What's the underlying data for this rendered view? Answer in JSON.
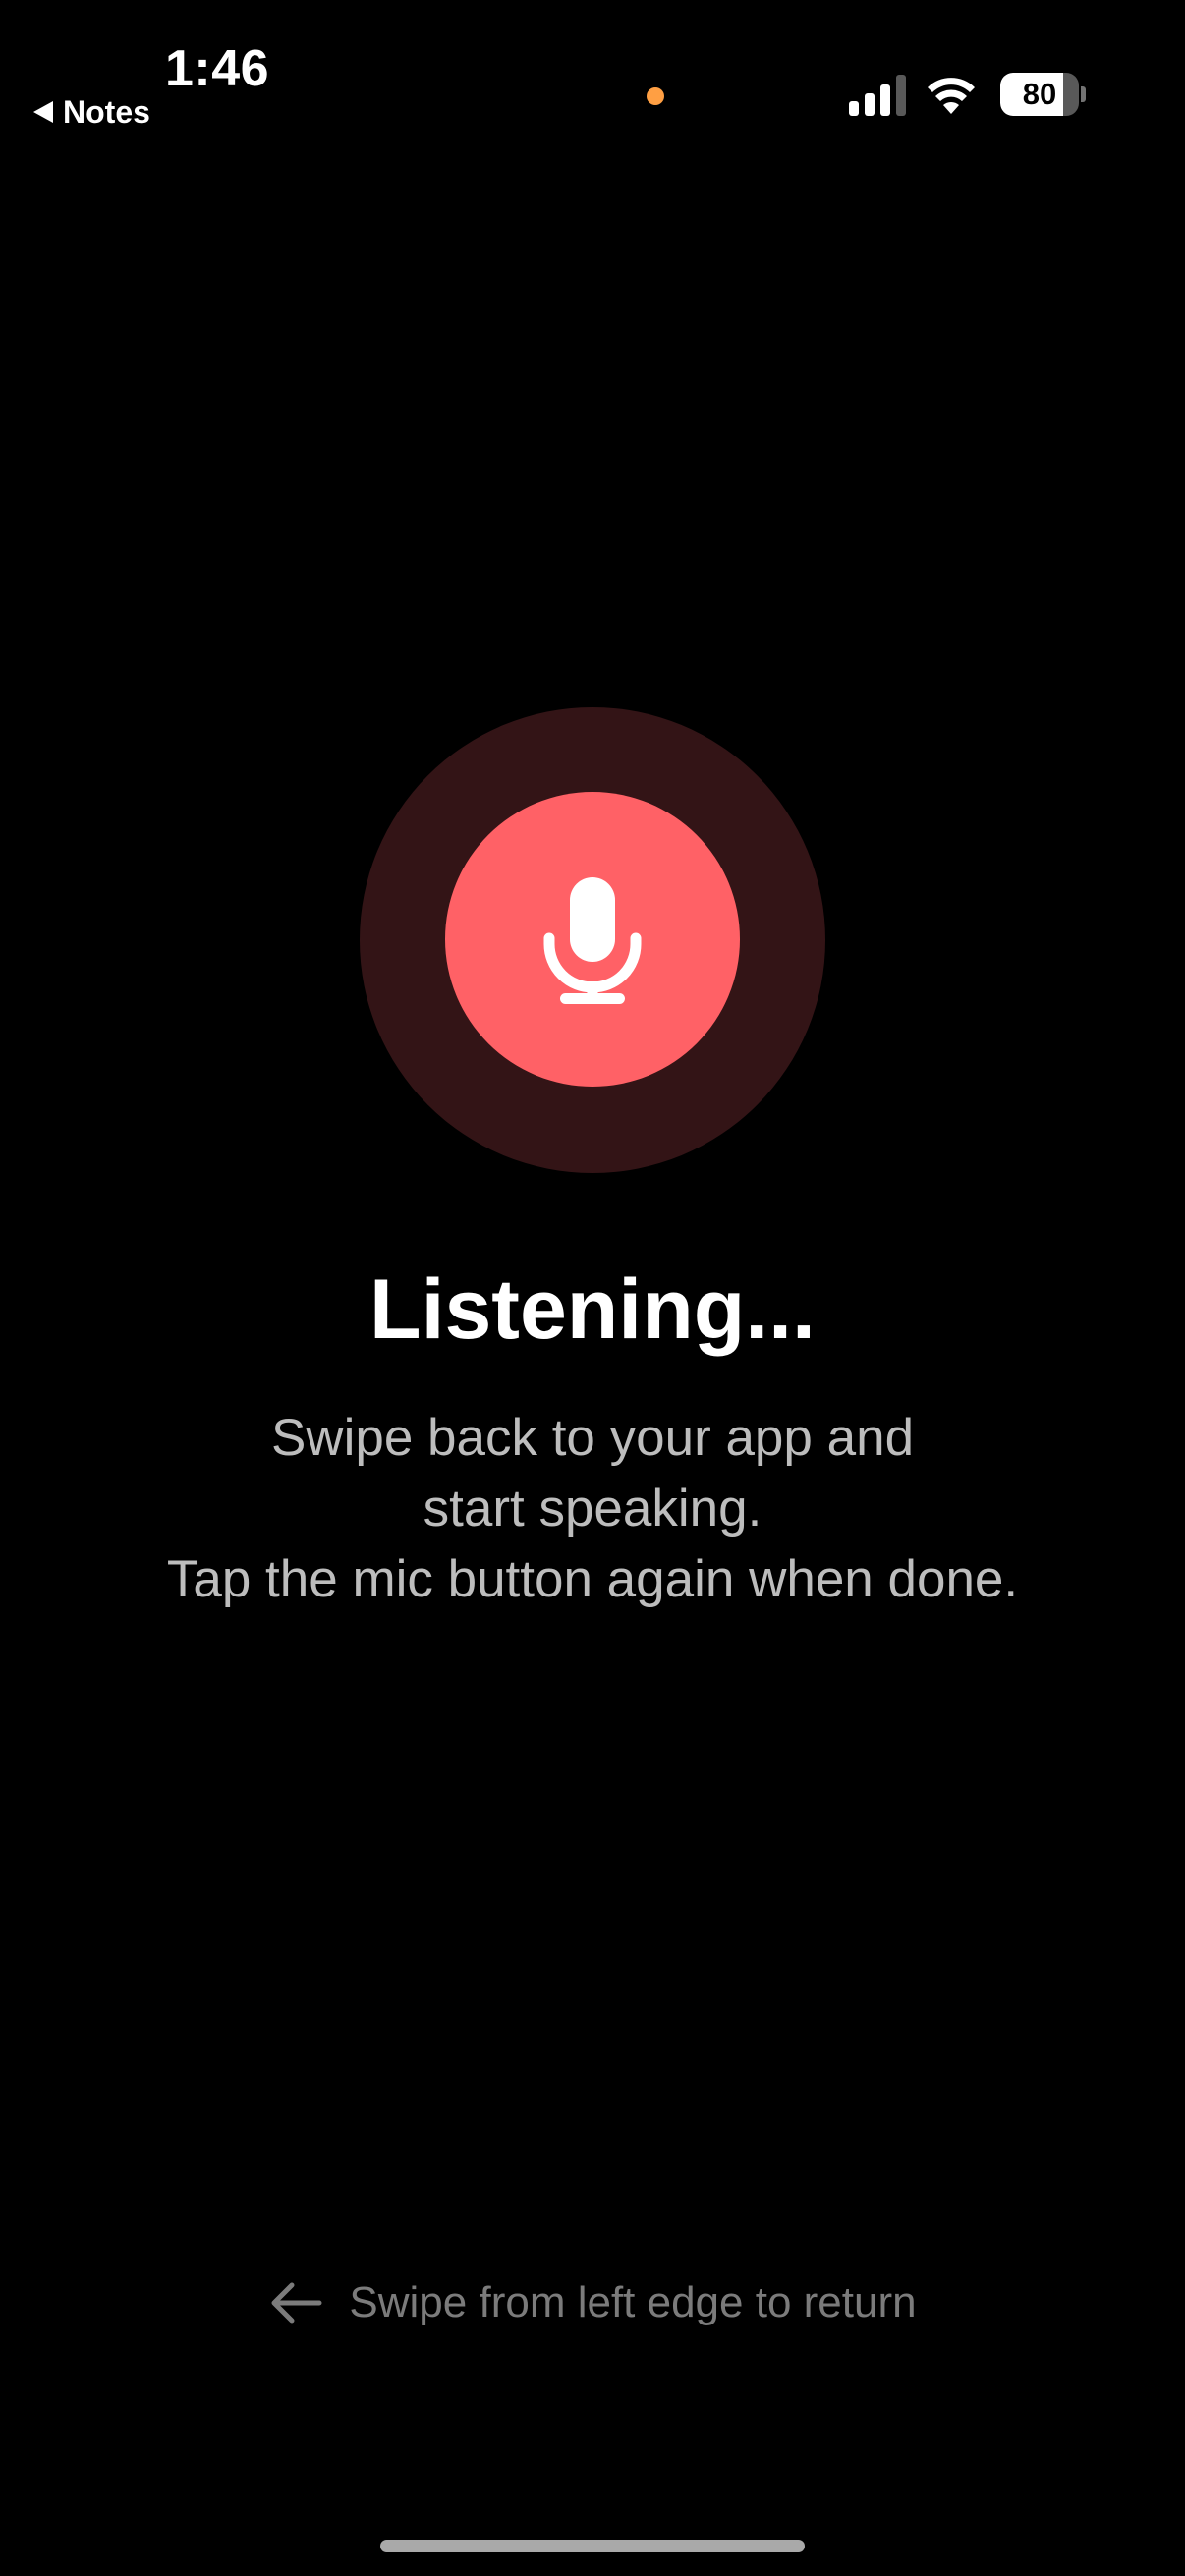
{
  "status_bar": {
    "time": "1:46",
    "back_app_label": "Notes",
    "battery_percent": 80,
    "battery_text": "80",
    "privacy_indicator_color": "#ff9f43",
    "icons": [
      "back-triangle-icon",
      "cellular-signal-icon",
      "wifi-icon",
      "battery-icon"
    ]
  },
  "mic": {
    "icon": "microphone-icon",
    "button_color": "#ff6166",
    "halo_color": "#331416",
    "state": "listening"
  },
  "content": {
    "title": "Listening...",
    "desc_line1": "Swipe back to your app and",
    "desc_line2": "start speaking.",
    "desc_line3": "Tap the mic button again when done."
  },
  "footer": {
    "hint_icon": "arrow-left-icon",
    "hint_text": "Swipe from left edge to return"
  }
}
